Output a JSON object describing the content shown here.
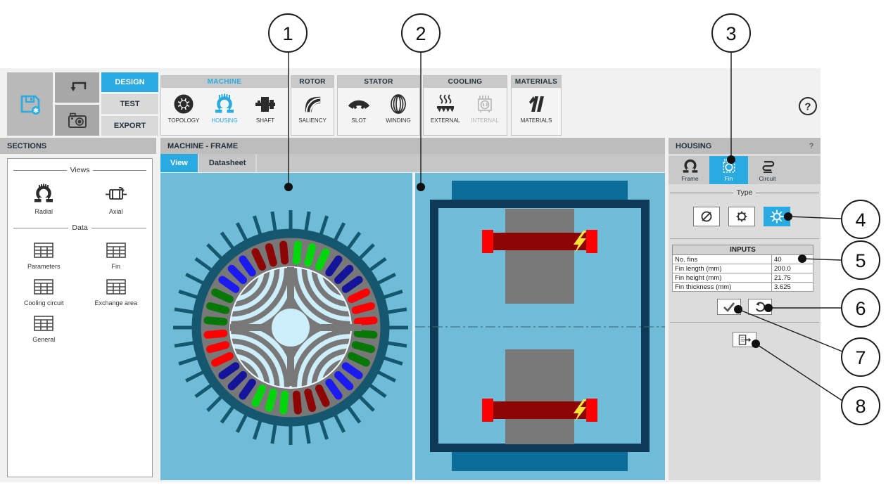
{
  "colors": {
    "accent": "#29abe2",
    "canvas_blue": "#6ebcd7",
    "fin_teal": "#14576e",
    "stator_gray": "#787878",
    "rotor_pale": "#cdeefb",
    "frame_navy": "#0e3a57",
    "end_cap_blue": "#0c6c9a",
    "winding_dark_red": "#8e0505",
    "winding_bright_red": "#fb0202",
    "bolt_yellow": "#ffe23c"
  },
  "toolbar": {
    "tabs": [
      {
        "label": "DESIGN",
        "active": true
      },
      {
        "label": "TEST",
        "active": false
      },
      {
        "label": "EXPORT",
        "active": false
      }
    ],
    "help_label": "?",
    "groups": [
      {
        "label": "MACHINE",
        "items": [
          {
            "label": "TOPOLOGY"
          },
          {
            "label": "HOUSING",
            "active": true
          },
          {
            "label": "SHAFT"
          }
        ]
      },
      {
        "label": "ROTOR",
        "items": [
          {
            "label": "SALIENCY"
          }
        ]
      },
      {
        "label": "STATOR",
        "items": [
          {
            "label": "SLOT"
          },
          {
            "label": "WINDING"
          }
        ]
      },
      {
        "label": "COOLING",
        "items": [
          {
            "label": "EXTERNAL"
          },
          {
            "label": "INTERNAL",
            "disabled": true
          }
        ]
      },
      {
        "label": "MATERIALS",
        "items": [
          {
            "label": "MATERIALS"
          }
        ]
      }
    ]
  },
  "sections": {
    "title": "SECTIONS",
    "views_label": "Views",
    "view_items": [
      {
        "label": "Radial"
      },
      {
        "label": "Axial"
      }
    ],
    "data_label": "Data",
    "data_items": [
      {
        "label": "Parameters"
      },
      {
        "label": "Fin"
      },
      {
        "label": "Cooling circuit"
      },
      {
        "label": "Exchange area"
      },
      {
        "label": "General"
      }
    ]
  },
  "main": {
    "title": "MACHINE - FRAME",
    "tabs": [
      {
        "label": "View",
        "active": true
      },
      {
        "label": "Datasheet",
        "active": false
      }
    ]
  },
  "housing": {
    "title": "HOUSING",
    "help": "?",
    "tabs": [
      {
        "label": "Frame"
      },
      {
        "label": "Fin",
        "active": true
      },
      {
        "label": "Circuit"
      }
    ],
    "type_label": "Type",
    "type_options": [
      {
        "name": "no-fins"
      },
      {
        "name": "axial-fins"
      },
      {
        "name": "radial-fins",
        "active": true
      }
    ],
    "inputs": {
      "header": "INPUTS",
      "rows": [
        {
          "label": "No. fins",
          "value": "40"
        },
        {
          "label": "Fin length (mm)",
          "value": "200.0"
        },
        {
          "label": "Fin height (mm)",
          "value": "21.75"
        },
        {
          "label": "Fin thickness (mm)",
          "value": "3.625"
        }
      ]
    }
  },
  "machine": {
    "num_fins": 40,
    "num_slots": 36,
    "slots_per_group": 3,
    "phase_colors": [
      "#00d60b",
      "#14149b",
      "#fb0202",
      "#077807",
      "#1b1bf0",
      "#8e0505"
    ]
  },
  "callouts": [
    {
      "label": "1"
    },
    {
      "label": "2"
    },
    {
      "label": "3"
    },
    {
      "label": "4"
    },
    {
      "label": "5"
    },
    {
      "label": "6"
    },
    {
      "label": "7"
    },
    {
      "label": "8"
    }
  ]
}
